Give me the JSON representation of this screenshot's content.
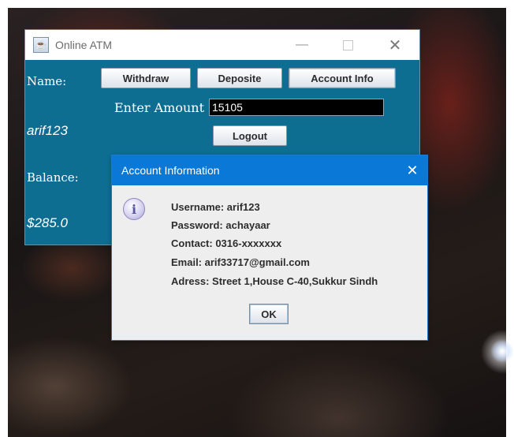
{
  "atm_window": {
    "title": "Online ATM",
    "name_label": "Name:",
    "name_value": "arif123",
    "balance_label": "Balance:",
    "balance_value": "$285.0",
    "buttons": {
      "withdraw": "Withdraw",
      "deposit": "Deposite",
      "account_info": "Account Info",
      "logout": "Logout"
    },
    "amount_label": "Enter Amount",
    "amount_value": "15105",
    "window_controls": {
      "minimize": "—",
      "close": "✕"
    }
  },
  "dialog": {
    "title": "Account Information",
    "close_glyph": "✕",
    "icon": "info-icon",
    "icon_glyph": "i",
    "lines": [
      "Username: arif123",
      "Password: achayaar",
      "Contact: 0316-xxxxxxx",
      "Email: arif33717@gmail.com",
      "Adress: Street 1,House C-40,Sukkur Sindh"
    ],
    "ok_label": "OK"
  },
  "colors": {
    "atm_background": "#0d6e92",
    "dialog_titlebar": "#0a78d7",
    "input_background": "#000000"
  }
}
